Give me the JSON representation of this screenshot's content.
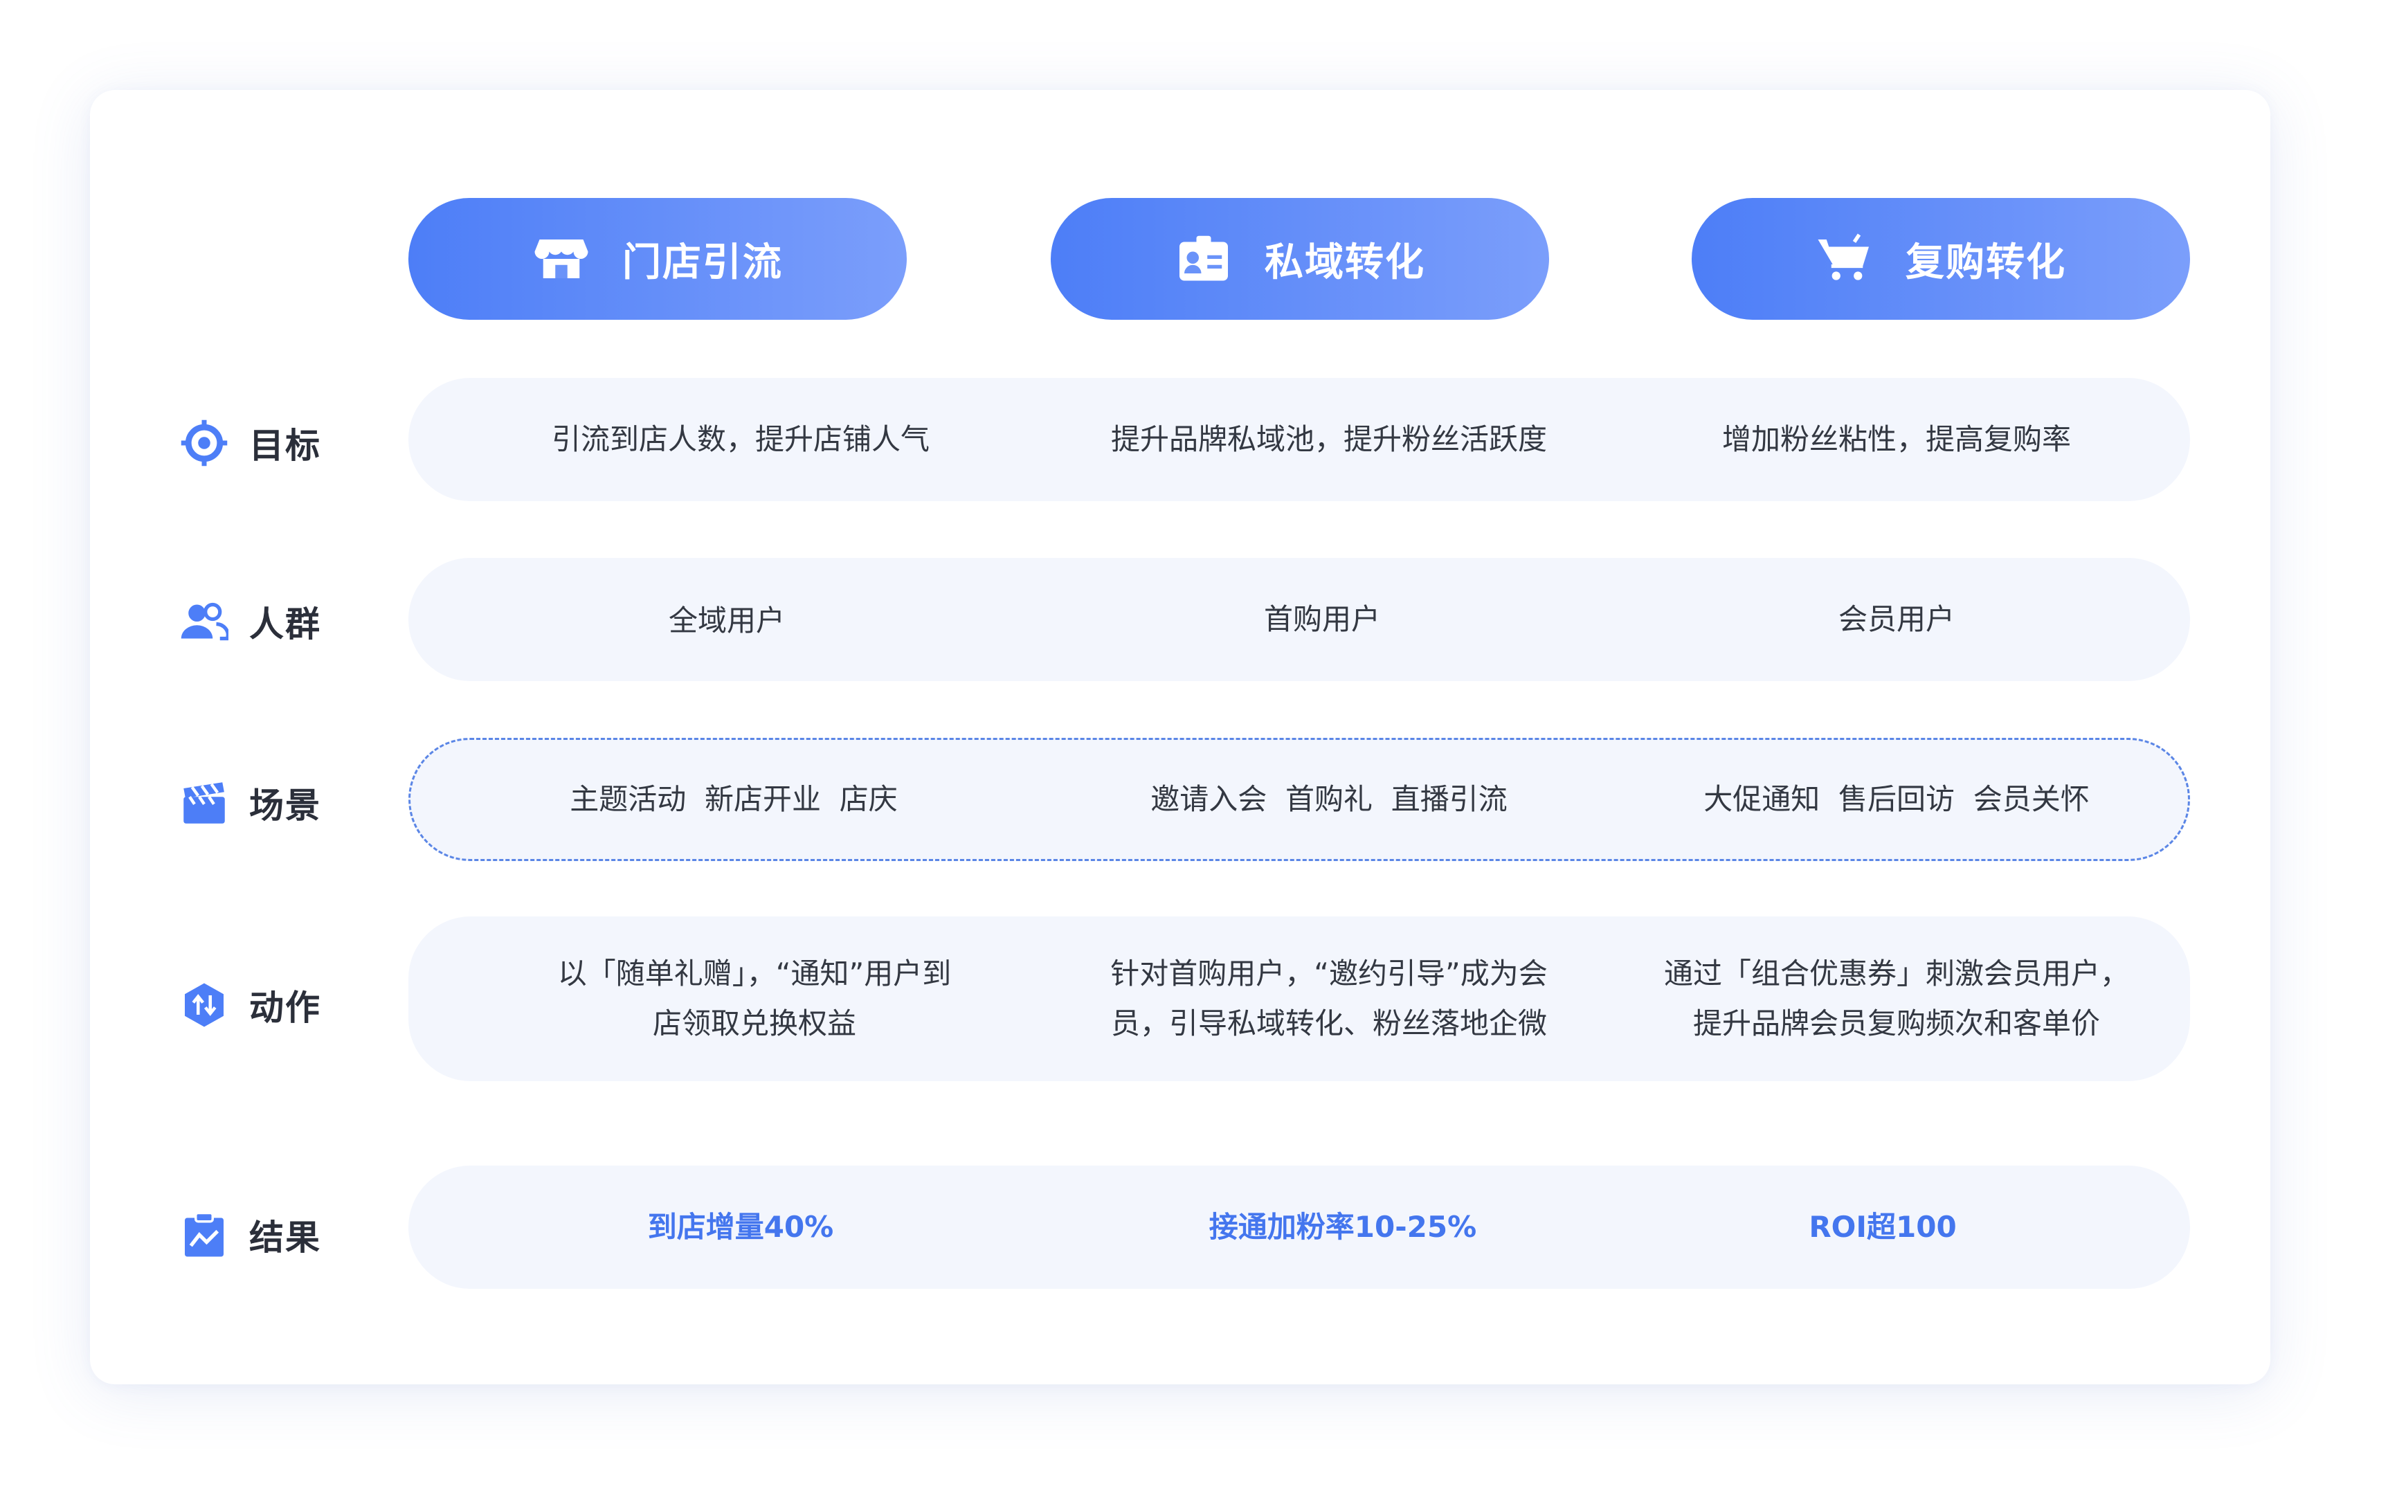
{
  "headers": [
    {
      "label": "门店引流",
      "icon": "store-icon"
    },
    {
      "label": "私域转化",
      "icon": "id-card-icon"
    },
    {
      "label": "复购转化",
      "icon": "shopping-cart-icon"
    }
  ],
  "rows": [
    {
      "label": "目标",
      "icon": "target-icon",
      "cells": [
        "引流到店人数，提升店铺人气",
        "提升品牌私域池，提升粉丝活跃度",
        "增加粉丝粘性，提高复购率"
      ]
    },
    {
      "label": "人群",
      "icon": "users-icon",
      "cells": [
        "全域用户",
        "首购用户",
        "会员用户"
      ]
    },
    {
      "label": "场景",
      "icon": "clapperboard-icon",
      "cells": [
        "主题活动  新店开业  店庆",
        "邀请入会  首购礼  直播引流",
        "大促通知  售后回访  会员关怀"
      ]
    },
    {
      "label": "动作",
      "icon": "action-icon",
      "cells": [
        [
          "以「随单礼赠」，“通知”用户到",
          "店领取兑换权益"
        ],
        [
          "针对首购用户，“邀约引导”成为会",
          "员，引导私域转化、粉丝落地企微"
        ],
        [
          "通过「组合优惠券」刺激会员用户，",
          "提升品牌会员复购频次和客单价"
        ]
      ]
    },
    {
      "label": "结果",
      "icon": "clipboard-chart-icon",
      "cells": [
        "到店增量40%",
        "接通加粉率10-25%",
        "ROI超100"
      ]
    }
  ],
  "colors": {
    "accent": "#4d7ef7",
    "accent_light": "#7b9efb",
    "row_bg": "#f3f6fd",
    "result_text": "#4476ee",
    "body_text": "#333842"
  }
}
